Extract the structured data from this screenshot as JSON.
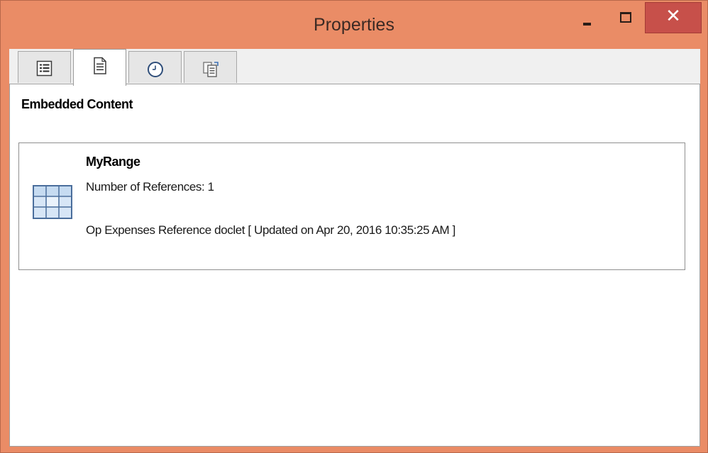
{
  "window": {
    "title": "Properties",
    "minimize_icon": "minimize-icon",
    "maximize_icon": "maximize-icon",
    "close_icon": "close-icon",
    "close_glyph": "✕",
    "colors": {
      "titlebar": "#ea8c66",
      "close_button": "#c7504a"
    }
  },
  "tabs": [
    {
      "icon": "list-icon",
      "active": false
    },
    {
      "icon": "document-icon",
      "active": true
    },
    {
      "icon": "clock-icon",
      "active": false
    },
    {
      "icon": "documents-icon",
      "active": false
    }
  ],
  "panel": {
    "section_title": "Embedded Content",
    "item": {
      "icon": "range-grid-icon",
      "name": "MyRange",
      "references": "Number of References: 1",
      "doclet_info": "Op Expenses Reference doclet [ Updated on Apr 20, 2016 10:35:25 AM ]"
    }
  }
}
